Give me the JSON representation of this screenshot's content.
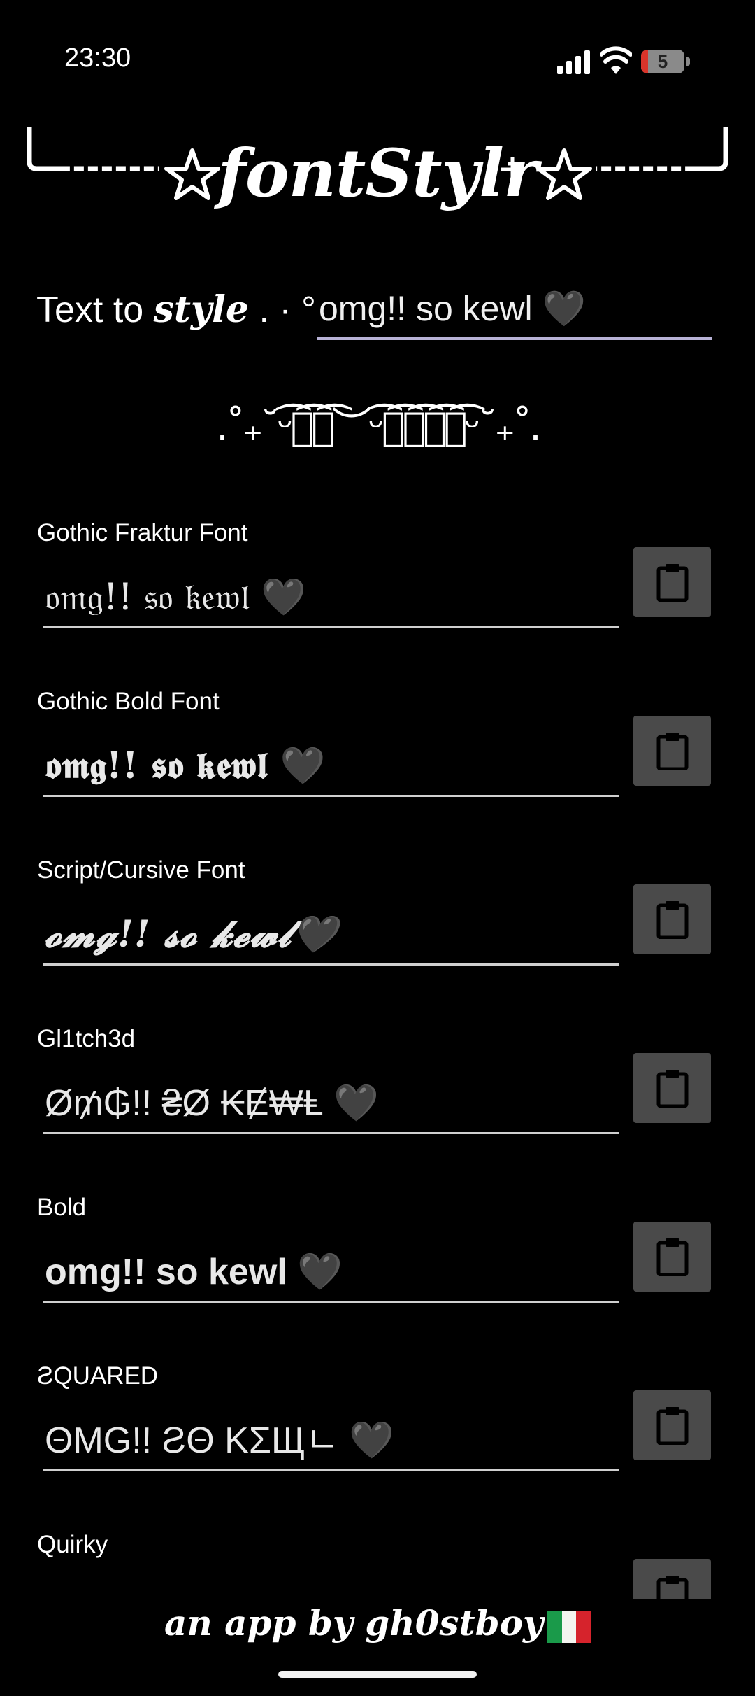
{
  "status_bar": {
    "time": "23:30",
    "battery": "5"
  },
  "banner": {
    "title": "fontStylr"
  },
  "input": {
    "label_prefix": "Text to ",
    "label_style": "style",
    "label_suffix": " . · °",
    "value": "omg!! so kewl 🖤"
  },
  "divider": ".˚₊˘ᵕ͡︶͡︶͡︶ᵕ͡︶͡︶͡︶͡︶͡ᵕ˘₊˚.",
  "fonts": [
    {
      "label": "Gothic Fraktur Font",
      "output": "𝔬𝔪𝔤!! 𝔰𝔬 𝔨𝔢𝔴𝔩 🖤"
    },
    {
      "label": "Gothic Bold Font",
      "output": "𝖔𝖒𝖌!! 𝖘𝖔 𝖐𝖊𝖜𝖑 🖤"
    },
    {
      "label": "Script/Cursive Font",
      "output": "𝓸𝓶𝓰!! 𝓼𝓸 𝓴𝓮𝔀𝓵🖤"
    },
    {
      "label": "Gl1tch3d",
      "output": "Ø₥₲!! ₴Ø ₭Ɇ₩Ⱡ 🖤"
    },
    {
      "label": "Bold",
      "output": "omg!! so kewl 🖤"
    },
    {
      "label": "ƧQUARED",
      "output": "ΘMG!! ƧΘ KΣЩㄴ 🖤"
    },
    {
      "label": "Quirky",
      "output": ""
    }
  ],
  "footer": {
    "text": "an app by gh0stboy"
  },
  "colors": {
    "background": "#000000",
    "copy_button": "#4a4a4a",
    "input_underline": "#b8b2d6",
    "flag_green": "#1a9a4a",
    "flag_white": "#f4f5f0",
    "flag_red": "#d6232c"
  }
}
